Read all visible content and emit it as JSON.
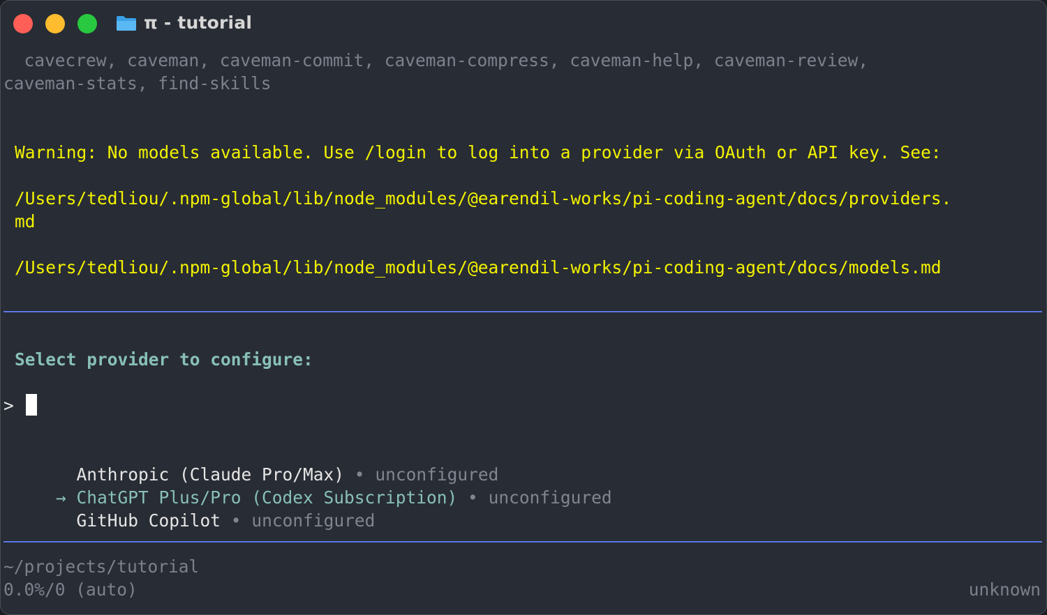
{
  "window": {
    "title": "π - tutorial",
    "folder_icon": "folder-icon"
  },
  "skills": {
    "line1": "  cavecrew, caveman, caveman-commit, caveman-compress, caveman-help, caveman-review,",
    "line2": "caveman-stats, find-skills"
  },
  "warning": {
    "line1": "Warning: No models available. Use /login to log into a provider via OAuth or API key. See:",
    "path1a": "/Users/tedliou/.npm-global/lib/node_modules/@earendil-works/pi-coding-agent/docs/providers.",
    "path1b": "md",
    "path2": "/Users/tedliou/.npm-global/lib/node_modules/@earendil-works/pi-coding-agent/docs/models.md"
  },
  "selector": {
    "heading": "Select provider to configure:",
    "prompt": ">",
    "search_value": "",
    "items": [
      {
        "marker": "  ",
        "name": "Anthropic (Claude Pro/Max)",
        "sep": " • ",
        "status": "unconfigured",
        "selected": false
      },
      {
        "marker": "→ ",
        "name": "ChatGPT Plus/Pro (Codex Subscription)",
        "sep": " • ",
        "status": "unconfigured",
        "selected": true
      },
      {
        "marker": "  ",
        "name": "GitHub Copilot",
        "sep": " • ",
        "status": "unconfigured",
        "selected": false
      }
    ]
  },
  "footer": {
    "cwd": "~/projects/tutorial",
    "usage": "0.0%/0 (auto)",
    "model": "unknown"
  },
  "colors": {
    "background": "#282c34",
    "warning": "#f2f200",
    "accent": "#88c0b8",
    "rule": "#5a78e6",
    "dim": "#7c828d"
  }
}
